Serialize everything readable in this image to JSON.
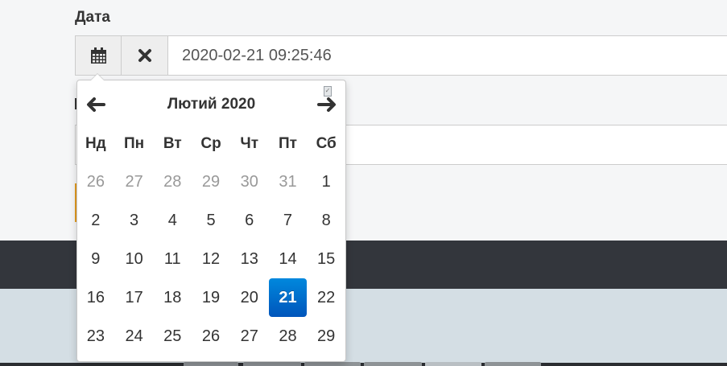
{
  "field": {
    "label": "Дата",
    "value": "2020-02-21 09:25:46",
    "calendar_button_icon": "calendar-icon",
    "clear_button_icon": "close-icon"
  },
  "datepicker": {
    "month_title": "Лютий 2020",
    "prev_icon": "arrow-left-icon",
    "next_icon": "arrow-right-icon",
    "weekdays": [
      "Нд",
      "Пн",
      "Вт",
      "Ср",
      "Чт",
      "Пт",
      "Сб"
    ],
    "weeks": [
      [
        {
          "d": "26",
          "old": true
        },
        {
          "d": "27",
          "old": true
        },
        {
          "d": "28",
          "old": true
        },
        {
          "d": "29",
          "old": true
        },
        {
          "d": "30",
          "old": true
        },
        {
          "d": "31",
          "old": true
        },
        {
          "d": "1"
        }
      ],
      [
        {
          "d": "2"
        },
        {
          "d": "3"
        },
        {
          "d": "4"
        },
        {
          "d": "5"
        },
        {
          "d": "6"
        },
        {
          "d": "7"
        },
        {
          "d": "8"
        }
      ],
      [
        {
          "d": "9"
        },
        {
          "d": "10"
        },
        {
          "d": "11"
        },
        {
          "d": "12"
        },
        {
          "d": "13"
        },
        {
          "d": "14"
        },
        {
          "d": "15"
        }
      ],
      [
        {
          "d": "16"
        },
        {
          "d": "17"
        },
        {
          "d": "18"
        },
        {
          "d": "19"
        },
        {
          "d": "20"
        },
        {
          "d": "21",
          "active": true
        },
        {
          "d": "22"
        }
      ],
      [
        {
          "d": "23"
        },
        {
          "d": "24"
        },
        {
          "d": "25"
        },
        {
          "d": "26"
        },
        {
          "d": "27"
        },
        {
          "d": "28"
        },
        {
          "d": "29"
        }
      ]
    ],
    "selected_day": "21",
    "accent_color": "#0068cc"
  },
  "colors": {
    "page_background": "#f5f6f7",
    "footer_dark": "#33363c",
    "footer_light": "#d4dee4",
    "button_orange": "#e39b1f"
  }
}
